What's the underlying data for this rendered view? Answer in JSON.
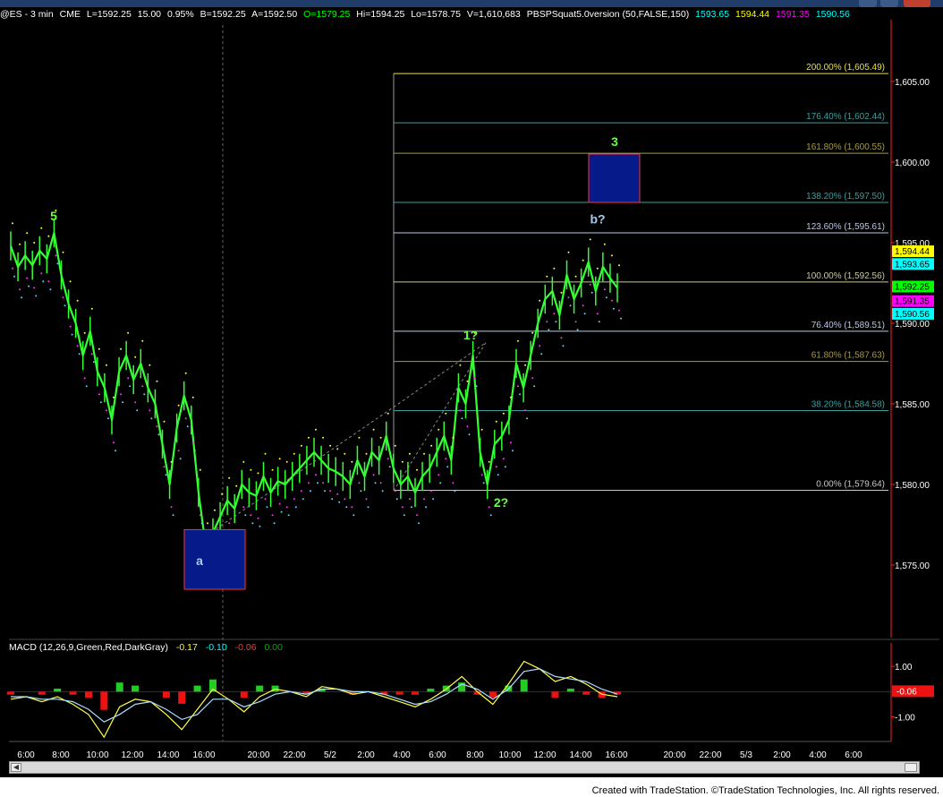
{
  "header": {
    "symbol": "@ES - 3 min",
    "exchange": "CME",
    "last": "L=1592.25",
    "change": "15.00",
    "change_pct": "0.95%",
    "bid": "B=1592.25",
    "ask": "A=1592.50",
    "open": "O=1579.25",
    "high": "Hi=1594.25",
    "low": "Lo=1578.75",
    "volume": "V=1,610,683",
    "indicator": "PBSPSquat5.0version (50,FALSE,150)",
    "ind_values": [
      {
        "text": "1593.65",
        "color": "#00ffff"
      },
      {
        "text": "1594.44",
        "color": "#ffff00"
      },
      {
        "text": "1591.35",
        "color": "#ff00ff"
      },
      {
        "text": "1590.56",
        "color": "#00ffff"
      }
    ]
  },
  "macd": {
    "label": "MACD (12,26,9,Green,Red,DarkGray)",
    "values": [
      {
        "text": "-0.17",
        "color": "#ffff00"
      },
      {
        "text": "-0.10",
        "color": "#00ffff"
      },
      {
        "text": "-0.06",
        "color": "#ff3333"
      },
      {
        "text": "0.00",
        "color": "#00aa00"
      }
    ],
    "axis_labels": [
      "1.00",
      "-1.00"
    ],
    "current_tag": "-0.06"
  },
  "footer": "Created with TradeStation. ©TradeStation Technologies, Inc. All rights reserved.",
  "chart_data": {
    "type": "candlestick",
    "title": "",
    "ylim": [
      1570.5,
      1608.5
    ],
    "y_ticks": [
      {
        "v": 1575,
        "label": "1,575.00"
      },
      {
        "v": 1580,
        "label": "1,580.00"
      },
      {
        "v": 1585,
        "label": "1,585.00"
      },
      {
        "v": 1590,
        "label": "1,590.00"
      },
      {
        "v": 1595,
        "label": "1,595.00"
      },
      {
        "v": 1600,
        "label": "1,600.00"
      },
      {
        "v": 1605,
        "label": "1,605.00"
      }
    ],
    "x_labels": [
      "6:00",
      "8:00",
      "10:00",
      "12:00",
      "14:00",
      "16:00",
      "20:00",
      "22:00",
      "5/2",
      "2:00",
      "4:00",
      "6:00",
      "8:00",
      "10:00",
      "12:00",
      "14:00",
      "16:00",
      "20:00",
      "22:00",
      "5/3",
      "2:00",
      "4:00",
      "6:00"
    ],
    "price_tags": [
      {
        "text": "1,594.44",
        "value": 1594.44,
        "bg": "#ffff00",
        "fg": "#000000"
      },
      {
        "text": "1,593.65",
        "value": 1593.65,
        "bg": "#00ffff",
        "fg": "#000000"
      },
      {
        "text": "1,592.25",
        "value": 1592.25,
        "bg": "#00ff00",
        "fg": "#000000"
      },
      {
        "text": "1,591.35",
        "value": 1591.35,
        "bg": "#ff00ff",
        "fg": "#000000"
      },
      {
        "text": "1,590.56",
        "value": 1590.56,
        "bg": "#00ffff",
        "fg": "#000000"
      }
    ],
    "fib_levels": [
      {
        "label": "200.00% (1,605.49)",
        "value": 1605.49,
        "color": "#e8e040"
      },
      {
        "label": "176.40% (1,602.44)",
        "value": 1602.44,
        "color": "#3aa0a0"
      },
      {
        "label": "161.80% (1,600.55)",
        "value": 1600.55,
        "color": "#a89a40"
      },
      {
        "label": "138.20% (1,597.50)",
        "value": 1597.5,
        "color": "#3aa0a0"
      },
      {
        "label": "123.60% (1,595.61)",
        "value": 1595.61,
        "color": "#b8c8e8"
      },
      {
        "label": "100.00% (1,592.56)",
        "value": 1592.56,
        "color": "#c8c8a0"
      },
      {
        "label": "76.40% (1,589.51)",
        "value": 1589.51,
        "color": "#b8c8e8"
      },
      {
        "label": "61.80% (1,587.63)",
        "value": 1587.63,
        "color": "#a89a40"
      },
      {
        "label": "38.20% (1,584.58)",
        "value": 1584.58,
        "color": "#3aa0a0"
      },
      {
        "label": "0.00% (1,579.64)",
        "value": 1579.64,
        "color": "#c8c8c8"
      }
    ],
    "wave_labels": [
      {
        "text": "5",
        "value": 1596.4,
        "color": "#66ff44"
      },
      {
        "text": "a",
        "value": 1575.0,
        "color": "#aaccee"
      },
      {
        "text": "1?",
        "value": 1589.0,
        "color": "#66ff44"
      },
      {
        "text": "2?",
        "value": 1578.6,
        "color": "#66ff44"
      },
      {
        "text": "3",
        "value": 1601.0,
        "color": "#66ff44"
      },
      {
        "text": "b?",
        "value": 1596.2,
        "color": "#aaccee"
      }
    ],
    "target_boxes": [
      {
        "low": 1597.5,
        "high": 1600.5
      },
      {
        "low": 1573.5,
        "high": 1577.2
      }
    ],
    "price_path": [
      1594.8,
      1593.5,
      1594.2,
      1593.6,
      1594.5,
      1594.0,
      1595.6,
      1593.0,
      1591.2,
      1590.0,
      1588.0,
      1589.5,
      1587.0,
      1586.0,
      1584.0,
      1587.0,
      1588.0,
      1586.5,
      1587.5,
      1586.0,
      1585.0,
      1582.5,
      1580.0,
      1583.5,
      1585.5,
      1584.0,
      1579.5,
      1576.2,
      1577.0,
      1578.0,
      1579.0,
      1578.5,
      1580.0,
      1579.5,
      1579.3,
      1580.5,
      1579.5,
      1580.2,
      1580.0,
      1580.5,
      1581.0,
      1581.5,
      1582.0,
      1581.5,
      1581.0,
      1580.8,
      1580.5,
      1580.0,
      1581.5,
      1580.5,
      1582.0,
      1581.5,
      1583.0,
      1581.0,
      1580.0,
      1580.5,
      1579.5,
      1580.5,
      1581.0,
      1582.0,
      1583.0,
      1581.5,
      1586.0,
      1585.0,
      1588.0,
      1582.0,
      1580.0,
      1582.5,
      1583.0,
      1584.0,
      1587.5,
      1586.0,
      1588.0,
      1590.0,
      1591.5,
      1592.0,
      1590.5,
      1593.0,
      1591.5,
      1592.5,
      1593.8,
      1592.0,
      1593.5,
      1592.8,
      1592.2
    ],
    "macd_line": [
      -0.3,
      -0.2,
      -0.4,
      -0.2,
      -0.5,
      -0.9,
      -1.8,
      -0.6,
      -0.3,
      -0.4,
      -0.9,
      -1.5,
      -0.7,
      0.1,
      -0.3,
      -0.8,
      -0.2,
      0.1,
      0.0,
      -0.2,
      0.2,
      0.1,
      -0.1,
      0.0,
      -0.2,
      -0.4,
      -0.6,
      -0.3,
      0.1,
      0.6,
      0.0,
      -0.5,
      0.3,
      1.2,
      0.9,
      0.4,
      0.6,
      0.3,
      -0.1,
      -0.2
    ],
    "signal_line": [
      -0.2,
      -0.2,
      -0.3,
      -0.3,
      -0.4,
      -0.7,
      -1.2,
      -0.9,
      -0.5,
      -0.4,
      -0.7,
      -1.1,
      -0.9,
      -0.3,
      -0.3,
      -0.6,
      -0.4,
      -0.1,
      0.0,
      -0.1,
      0.1,
      0.1,
      0.0,
      0.0,
      -0.1,
      -0.3,
      -0.5,
      -0.4,
      -0.1,
      0.3,
      0.1,
      -0.3,
      0.1,
      0.8,
      0.9,
      0.6,
      0.5,
      0.4,
      0.1,
      -0.1
    ]
  }
}
